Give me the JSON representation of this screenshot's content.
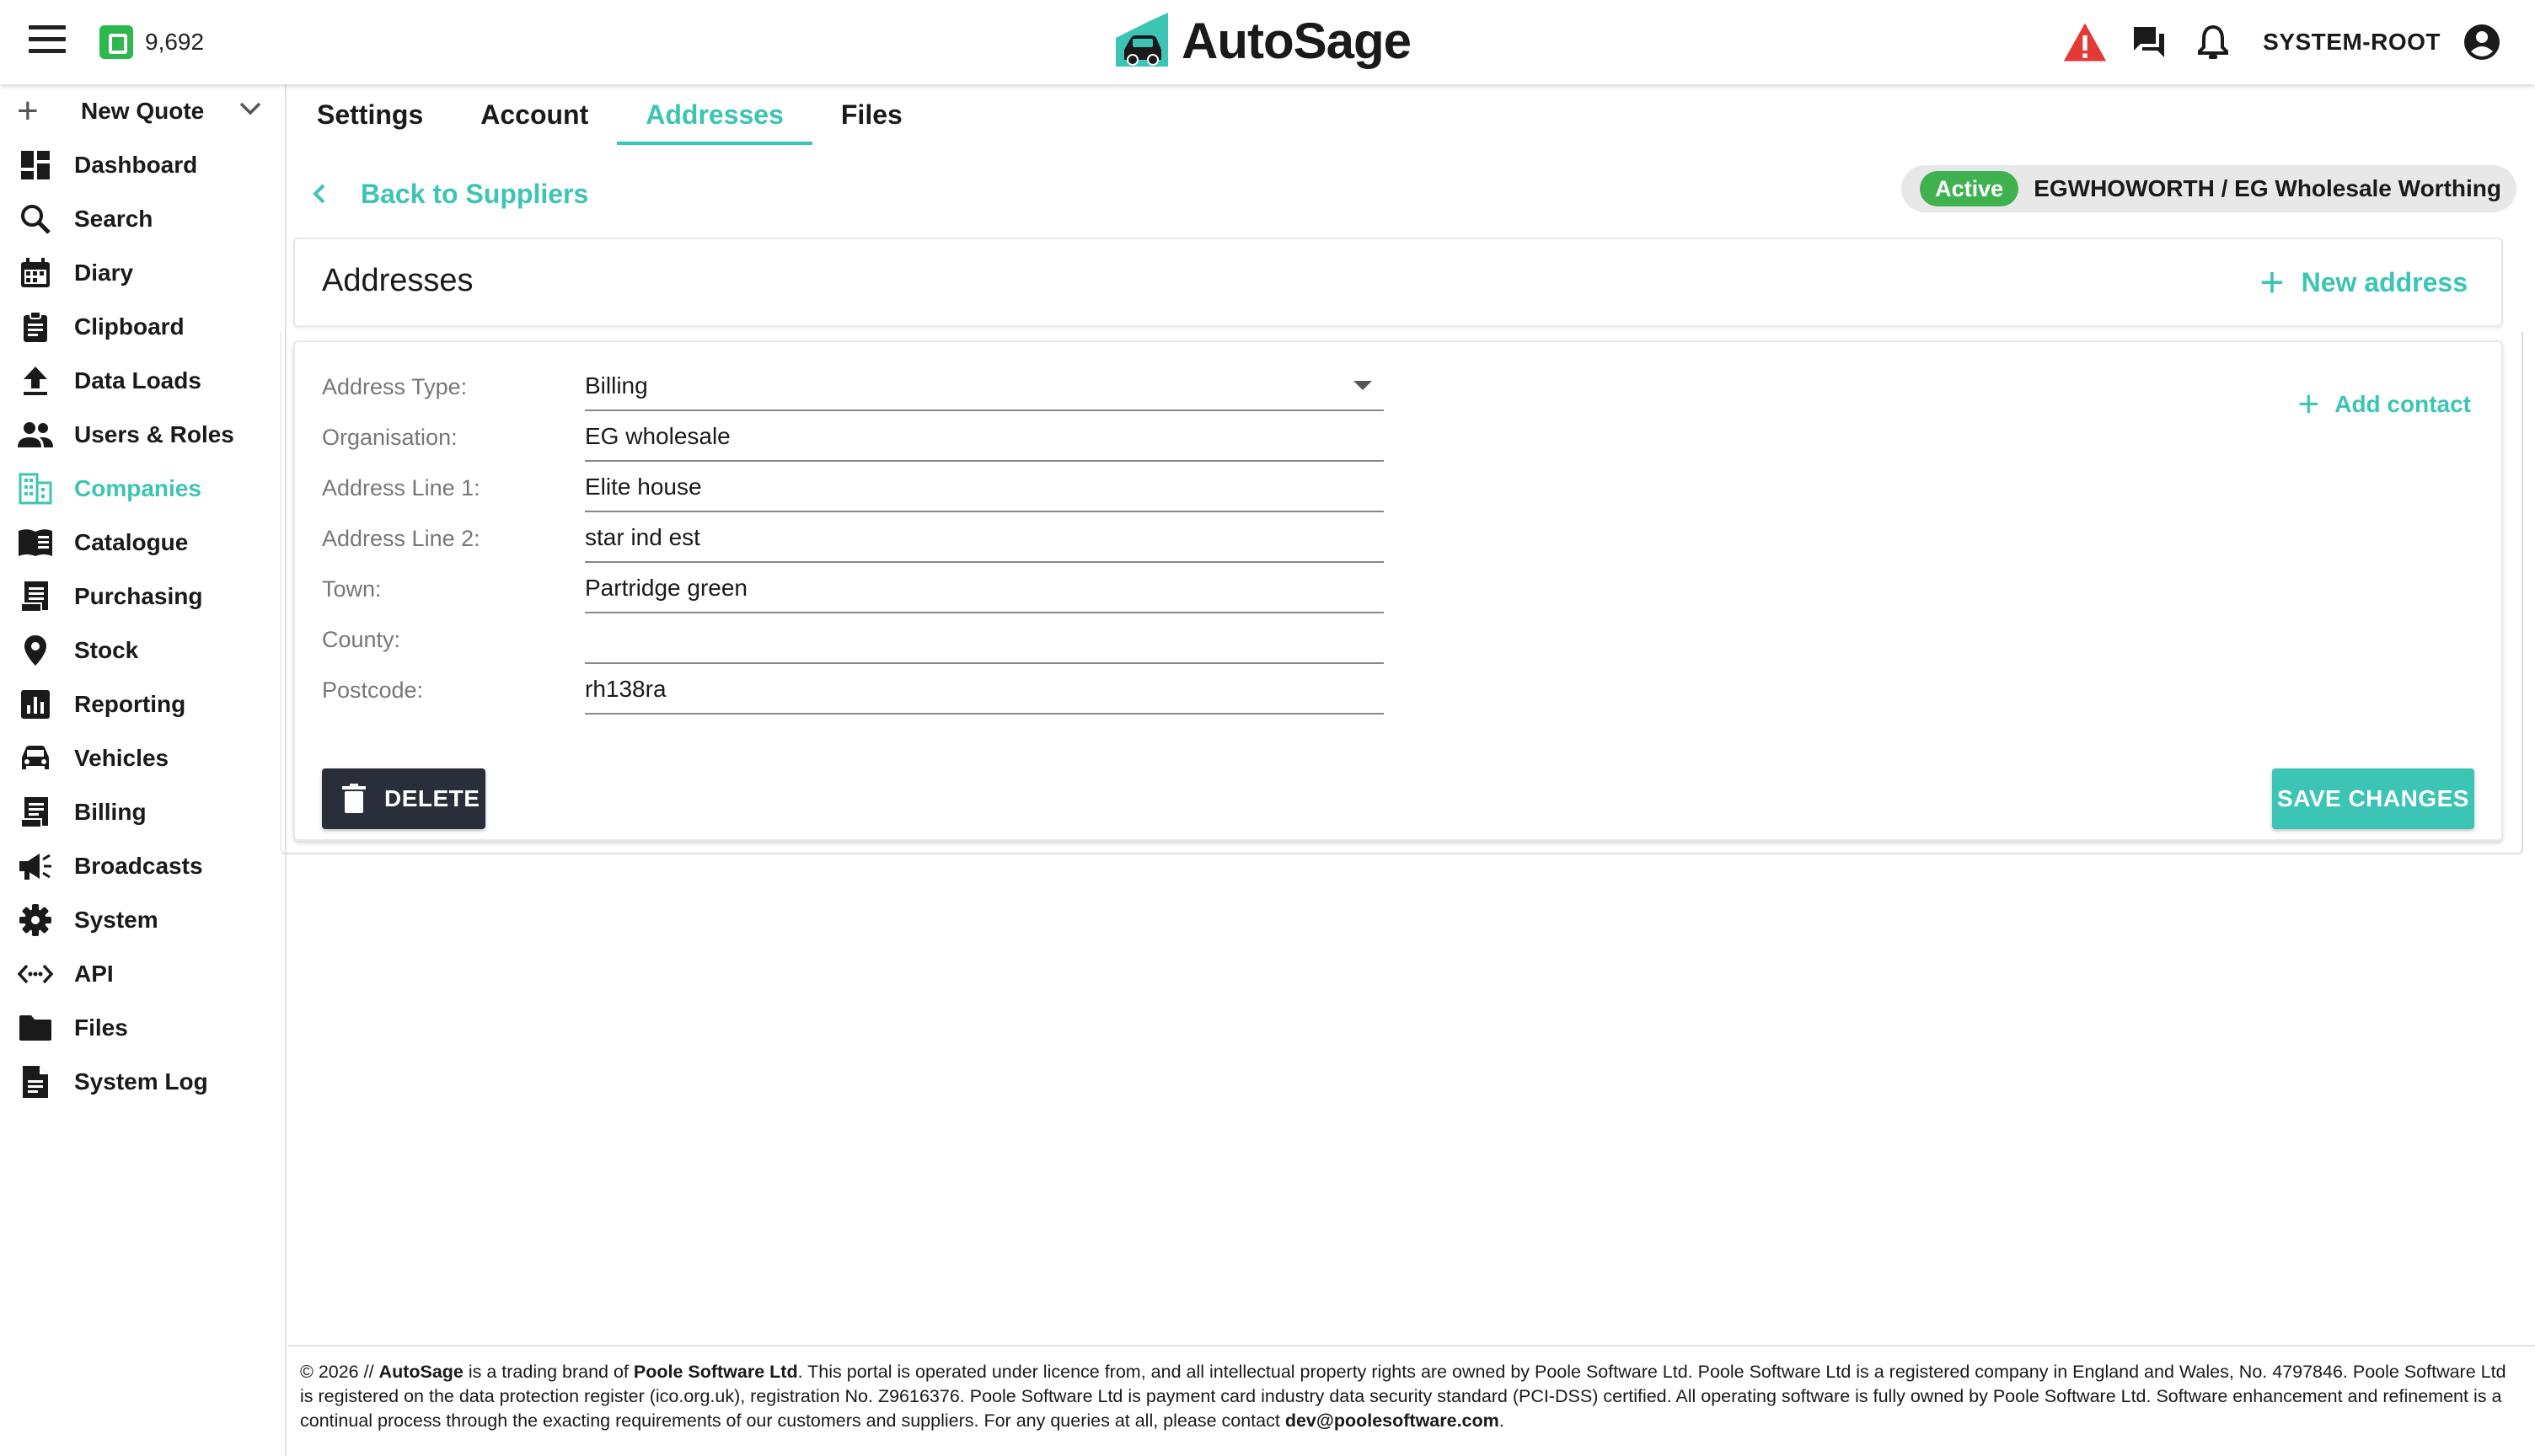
{
  "header": {
    "credits": "9,692",
    "logo_text": "AutoSage",
    "user": "SYSTEM-ROOT"
  },
  "sidebar": {
    "new_quote": "New Quote",
    "items": [
      {
        "label": "Dashboard",
        "icon": "dashboard-icon"
      },
      {
        "label": "Search",
        "icon": "search-icon"
      },
      {
        "label": "Diary",
        "icon": "calendar-icon"
      },
      {
        "label": "Clipboard",
        "icon": "clipboard-icon"
      },
      {
        "label": "Data Loads",
        "icon": "upload-icon"
      },
      {
        "label": "Users & Roles",
        "icon": "people-icon"
      },
      {
        "label": "Companies",
        "icon": "building-icon",
        "active": true
      },
      {
        "label": "Catalogue",
        "icon": "book-icon"
      },
      {
        "label": "Purchasing",
        "icon": "receipt-icon"
      },
      {
        "label": "Stock",
        "icon": "location-pin-icon"
      },
      {
        "label": "Reporting",
        "icon": "chart-icon"
      },
      {
        "label": "Vehicles",
        "icon": "car-icon"
      },
      {
        "label": "Billing",
        "icon": "invoice-icon"
      },
      {
        "label": "Broadcasts",
        "icon": "megaphone-icon"
      },
      {
        "label": "System",
        "icon": "gear-icon"
      },
      {
        "label": "API",
        "icon": "code-icon"
      },
      {
        "label": "Files",
        "icon": "folder-icon"
      },
      {
        "label": "System Log",
        "icon": "document-icon"
      }
    ]
  },
  "tabs": [
    {
      "label": "Settings"
    },
    {
      "label": "Account"
    },
    {
      "label": "Addresses",
      "active": true
    },
    {
      "label": "Files"
    }
  ],
  "back_link": "Back to Suppliers",
  "status": {
    "badge": "Active",
    "text": "EGWHOWORTH / EG Wholesale Worthing"
  },
  "addresses": {
    "title": "Addresses",
    "new_address": "New address",
    "add_contact": "Add contact",
    "fields": [
      {
        "label": "Address Type:",
        "value": "Billing",
        "select": true
      },
      {
        "label": "Organisation:",
        "value": "EG wholesale"
      },
      {
        "label": "Address Line 1:",
        "value": "Elite house"
      },
      {
        "label": "Address Line 2:",
        "value": "star ind est"
      },
      {
        "label": "Town:",
        "value": "Partridge green"
      },
      {
        "label": "County:",
        "value": ""
      },
      {
        "label": "Postcode:",
        "value": "rh138ra"
      }
    ],
    "delete_label": "DELETE",
    "save_label": "SAVE CHANGES"
  },
  "footer": {
    "prefix": "© 2026 // ",
    "brand": "AutoSage",
    "part1": " is a trading brand of ",
    "company": "Poole Software Ltd",
    "part2": ". This portal is operated under licence from, and all intellectual property rights are owned by Poole Software Ltd. Poole Software Ltd is a registered company in England and Wales, No. 4797846. Poole Software Ltd is registered on the data protection register (ico.org.uk), registration No. Z9616376. Poole Software Ltd is payment card industry data security standard (PCI-DSS) certified. All operating software is fully owned by Poole Software Ltd. Software enhancement and refinement is a continual process through the exacting requirements of our customers and suppliers. For any queries at all, please contact ",
    "email": "dev@poolesoftware.com",
    "suffix": "."
  },
  "colors": {
    "accent": "#3cc4b4",
    "active_badge": "#3fb24f",
    "warning": "#e53935",
    "delete_button": "#2a2d3a"
  }
}
